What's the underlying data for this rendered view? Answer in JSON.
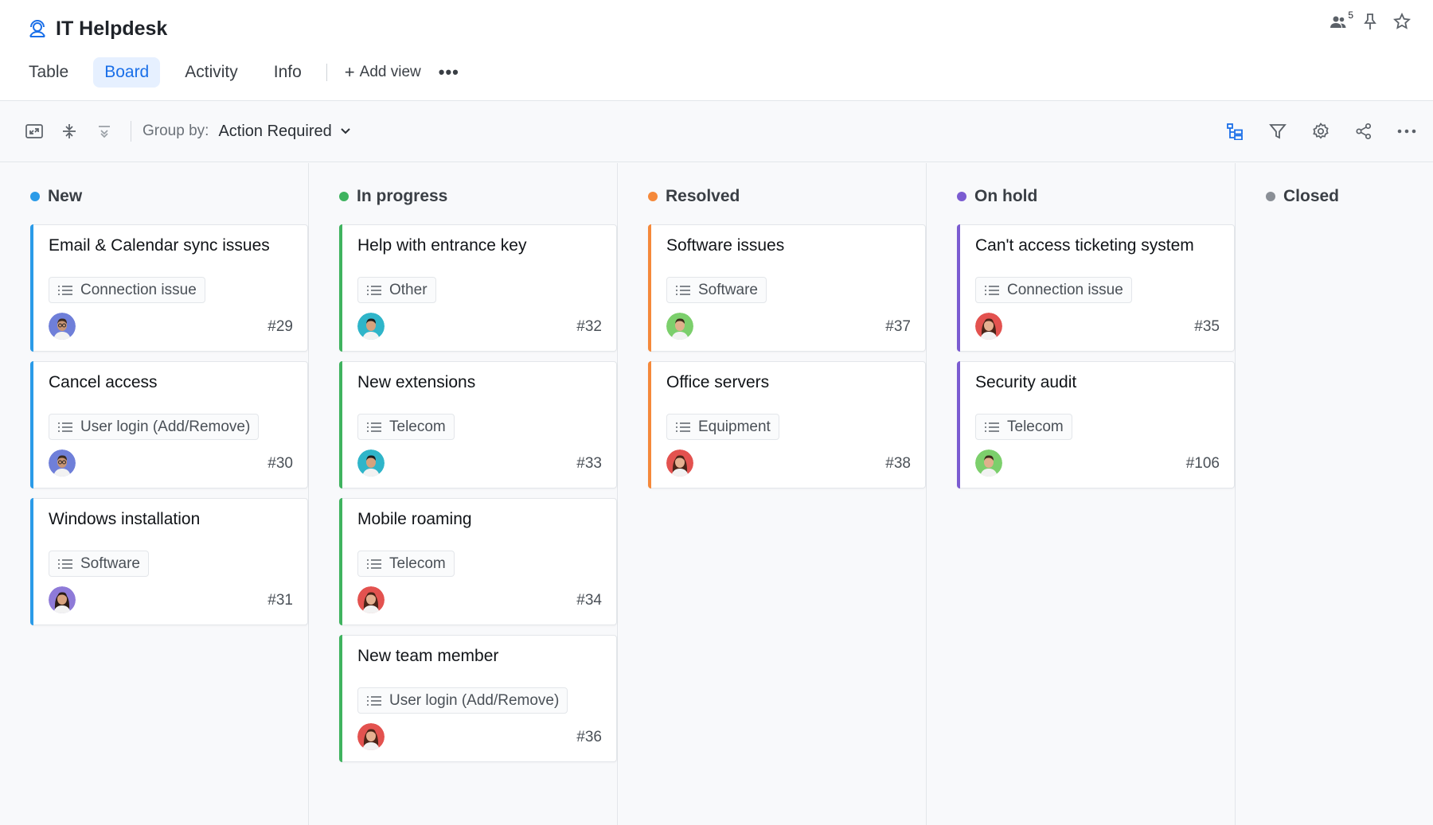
{
  "app": {
    "title": "IT Helpdesk",
    "members_count": "5"
  },
  "tabs": [
    {
      "label": "Table",
      "active": false
    },
    {
      "label": "Board",
      "active": true
    },
    {
      "label": "Activity",
      "active": false
    },
    {
      "label": "Info",
      "active": false
    }
  ],
  "add_view_label": "Add view",
  "toolbar": {
    "group_by_label": "Group by:",
    "group_by_value": "Action Required"
  },
  "colors": {
    "accent": "#1a6fe8",
    "new": "#2b9be8",
    "in_progress": "#3fb35f",
    "resolved": "#f5893a",
    "on_hold": "#7b5cd1",
    "closed": "#8a8f96"
  },
  "columns": [
    {
      "title": "New",
      "color": "#2b9be8",
      "cards": [
        {
          "title": "Email & Calendar sync issues",
          "tag": "Connection issue",
          "id": "#29",
          "avatar": "man-curly"
        },
        {
          "title": "Cancel access",
          "tag": "User login (Add/Remove)",
          "id": "#30",
          "avatar": "man-curly"
        },
        {
          "title": "Windows installation",
          "tag": "Software",
          "id": "#31",
          "avatar": "woman-dark"
        }
      ]
    },
    {
      "title": "In progress",
      "color": "#3fb35f",
      "cards": [
        {
          "title": "Help with entrance key",
          "tag": "Other",
          "id": "#32",
          "avatar": "man-teal"
        },
        {
          "title": "New extensions",
          "tag": "Telecom",
          "id": "#33",
          "avatar": "man-teal"
        },
        {
          "title": "Mobile roaming",
          "tag": "Telecom",
          "id": "#34",
          "avatar": "woman-red"
        },
        {
          "title": "New team member",
          "tag": "User login (Add/Remove)",
          "id": "#36",
          "avatar": "woman-red"
        }
      ]
    },
    {
      "title": "Resolved",
      "color": "#f5893a",
      "cards": [
        {
          "title": "Software issues",
          "tag": "Software",
          "id": "#37",
          "avatar": "man-green"
        },
        {
          "title": "Office servers",
          "tag": "Equipment",
          "id": "#38",
          "avatar": "woman-red"
        }
      ]
    },
    {
      "title": "On hold",
      "color": "#7b5cd1",
      "cards": [
        {
          "title": "Can't access ticketing system",
          "tag": "Connection issue",
          "id": "#35",
          "avatar": "woman-red"
        },
        {
          "title": "Security audit",
          "tag": "Telecom",
          "id": "#106",
          "avatar": "man-green"
        }
      ]
    },
    {
      "title": "Closed",
      "color": "#8a8f96",
      "cards": []
    }
  ]
}
